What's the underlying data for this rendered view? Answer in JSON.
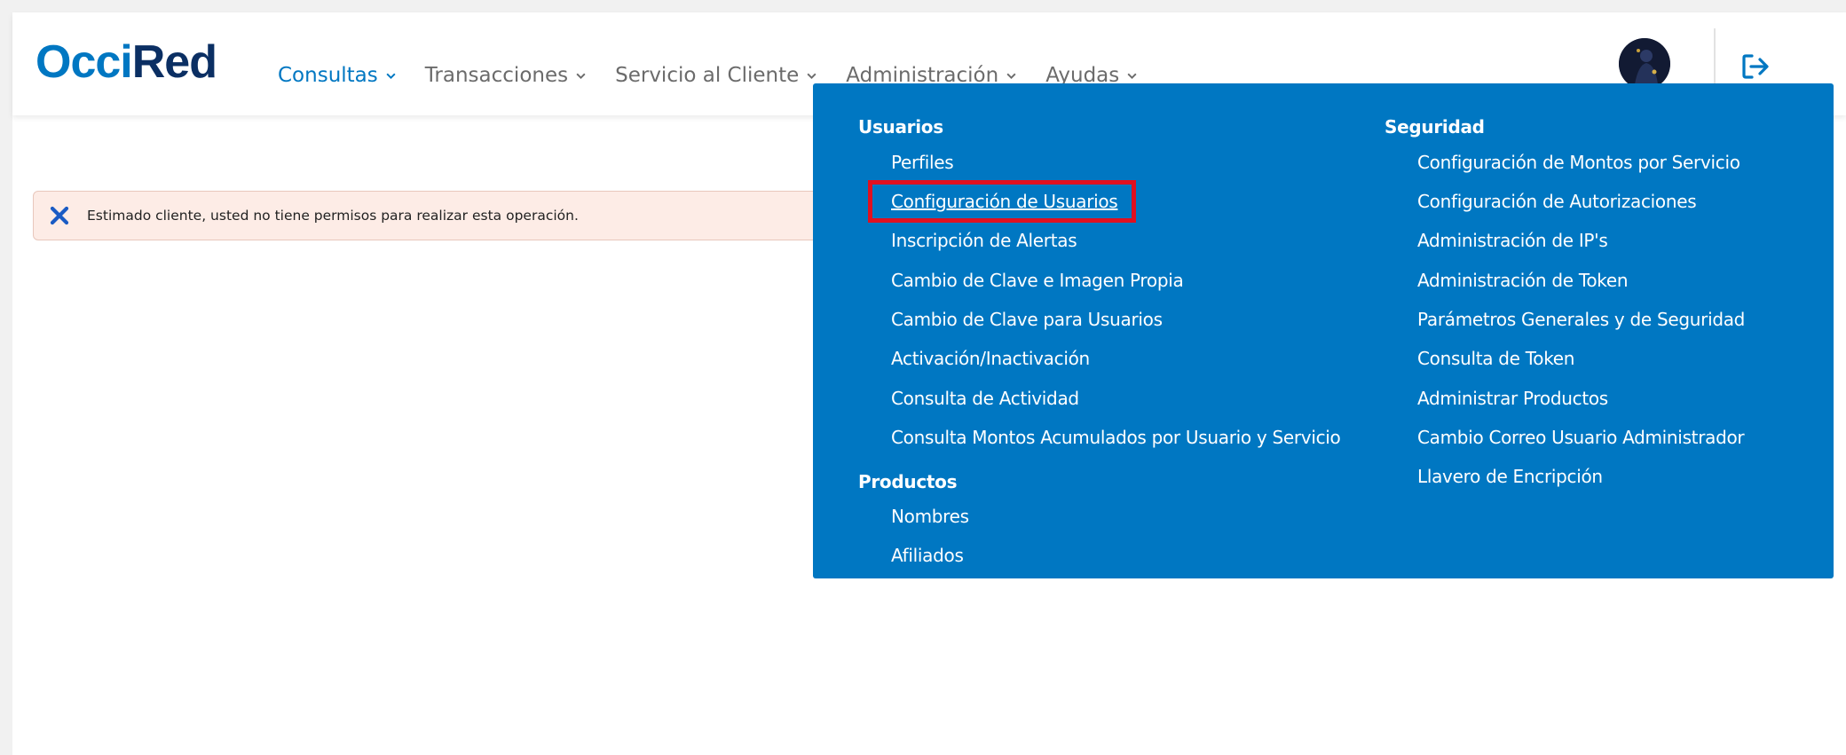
{
  "logo": {
    "part1": "Occi",
    "part2": "Red"
  },
  "nav": [
    {
      "label": "Consultas",
      "active": true
    },
    {
      "label": "Transacciones",
      "active": false
    },
    {
      "label": "Servicio al Cliente",
      "active": false
    },
    {
      "label": "Administración",
      "active": false
    },
    {
      "label": "Ayudas",
      "active": false
    }
  ],
  "alert": {
    "message": "Estimado cliente, usted no tiene permisos para realizar esta operación."
  },
  "menu": {
    "usuarios": {
      "title": "Usuarios",
      "items": [
        "Perfiles",
        "Configuración de Usuarios",
        "Inscripción de Alertas",
        "Cambio de Clave e Imagen Propia",
        "Cambio de Clave para Usuarios",
        "Activación/Inactivación",
        "Consulta de Actividad",
        "Consulta Montos Acumulados por Usuario y Servicio"
      ]
    },
    "productos": {
      "title": "Productos",
      "items": [
        "Nombres",
        "Afiliados"
      ]
    },
    "seguridad": {
      "title": "Seguridad",
      "items": [
        "Configuración de Montos por Servicio",
        "Configuración de Autorizaciones",
        "Administración de IP's",
        "Administración de Token",
        "Parámetros Generales y de Seguridad",
        "Consulta de Token",
        "Administrar Productos",
        "Cambio Correo Usuario Administrador",
        "Llavero de Encripción"
      ]
    }
  },
  "colors": {
    "primary": "#0077c2",
    "logo_dark": "#0b2f63",
    "alert_bg": "#fdece6",
    "highlight": "#e01020"
  },
  "icons": {
    "chevron": "chevron-down-icon",
    "logout": "logout-icon",
    "alert": "close-icon",
    "avatar": "avatar"
  }
}
